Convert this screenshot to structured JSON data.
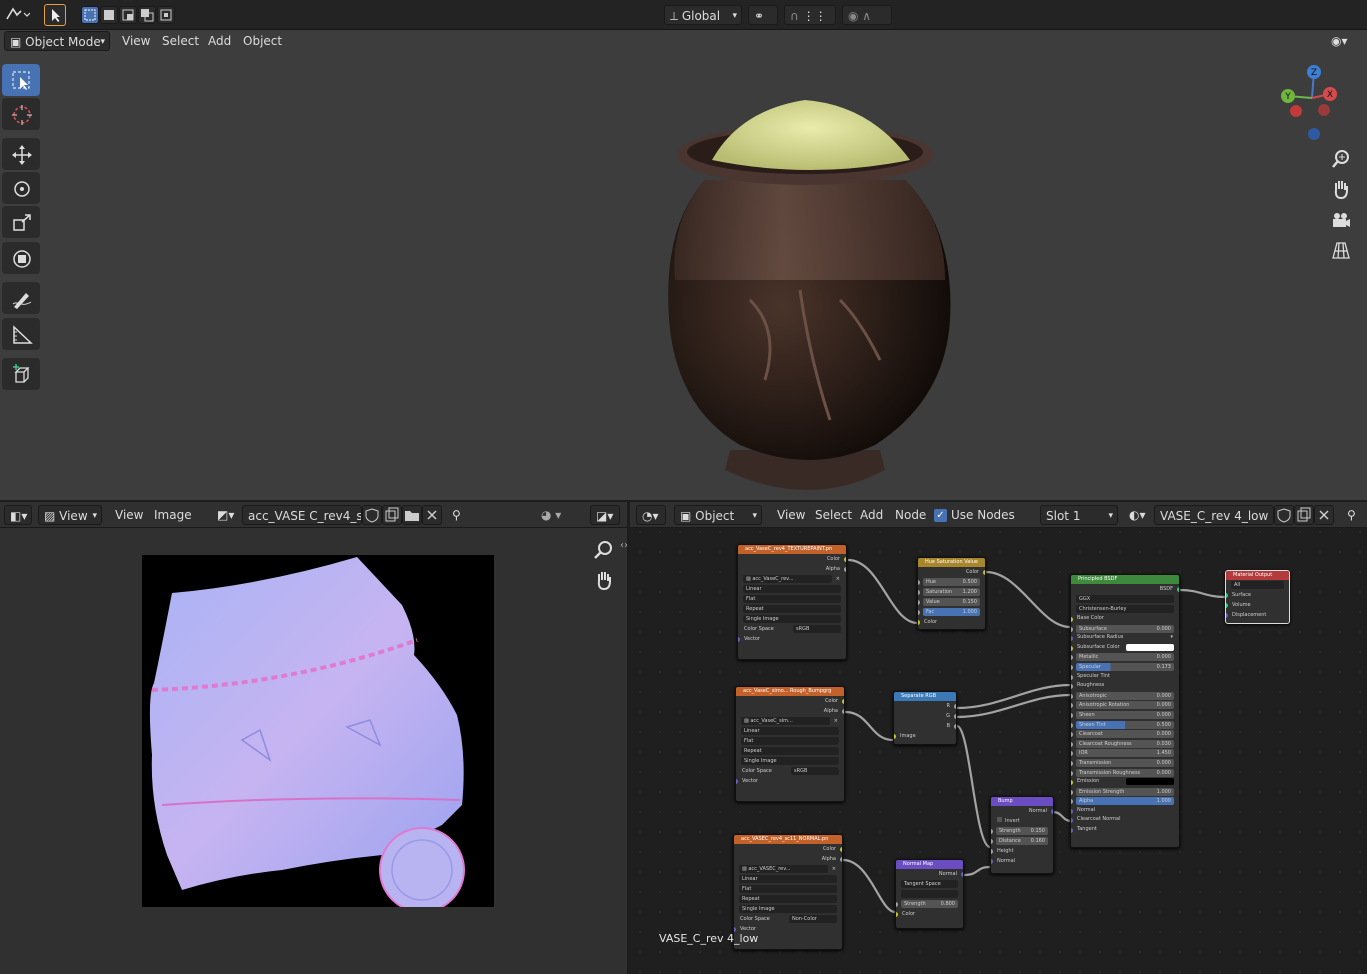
{
  "topbar": {
    "orientation": "Global"
  },
  "viewport": {
    "mode": "Object Mode",
    "menus": [
      "View",
      "Select",
      "Add",
      "Object"
    ],
    "gizmo": {
      "z": "Z",
      "y": "Y",
      "x": "X"
    }
  },
  "image_editor": {
    "view_dropdown": "View",
    "menus": [
      "View",
      "Image"
    ],
    "image_name": "acc_VASE C_rev4_si..."
  },
  "node_editor": {
    "object_dropdown": "Object",
    "menus": [
      "View",
      "Select",
      "Add",
      "Node"
    ],
    "use_nodes_label": "Use Nodes",
    "slot": "Slot 1",
    "material": "VASE_C_rev 4_low",
    "footer_label": "VASE_C_rev 4_low",
    "colors": {
      "accent": "#4772b3",
      "texture_header": "#c2622a",
      "color_header": "#a8862b",
      "converter_header": "#3a79b5",
      "vector_header": "#6a4ec1",
      "shader_header": "#3d8a3d",
      "output_header": "#b33b3b"
    },
    "nodes": {
      "tex1": {
        "title": "acc_VaseC_rev4_TEXTUREPAINT.pn",
        "out_color": "Color",
        "out_alpha": "Alpha",
        "image": "acc_VaseC_rev...",
        "interp": "Linear",
        "proj": "Flat",
        "ext": "Repeat",
        "src": "Single Image",
        "cs_label": "Color Space",
        "cs_value": "sRGB",
        "vector": "Vector"
      },
      "tex2": {
        "title": "acc_VaseC_simo... Rough_Bumpgrg",
        "out_color": "Color",
        "out_alpha": "Alpha",
        "image": "acc_VaseC_sim...",
        "interp": "Linear",
        "proj": "Flat",
        "ext": "Repeat",
        "src": "Single Image",
        "cs_label": "Color Space",
        "cs_value": "sRGB",
        "vector": "Vector"
      },
      "tex3": {
        "title": "acc_VASEC_rev4_sc11_NORMAL.pn",
        "out_color": "Color",
        "out_alpha": "Alpha",
        "image": "acc_VASEC_rev...",
        "interp": "Linear",
        "proj": "Flat",
        "ext": "Repeat",
        "src": "Single Image",
        "cs_label": "Color Space",
        "cs_value": "Non-Color",
        "vector": "Vector"
      },
      "hsv": {
        "title": "Hue Saturation Value",
        "out": "Color",
        "hue_l": "Hue",
        "hue_v": "0.500",
        "sat_l": "Saturation",
        "sat_v": "1.200",
        "val_l": "Value",
        "val_v": "0.150",
        "fac_l": "Fac",
        "fac_v": "1.000",
        "color_in": "Color"
      },
      "sep": {
        "title": "Separate RGB",
        "r": "R",
        "g": "G",
        "b": "B",
        "image": "Image"
      },
      "bump": {
        "title": "Bump",
        "out": "Normal",
        "invert": "Invert",
        "str_l": "Strength",
        "str_v": "0.150",
        "dist_l": "Distance",
        "dist_v": "0.160",
        "height": "Height",
        "normal": "Normal"
      },
      "nmap": {
        "title": "Normal Map",
        "out": "Normal",
        "space": "Tangent Space",
        "str_l": "Strength",
        "str_v": "0.800",
        "color": "Color"
      },
      "bsdf": {
        "title": "Principled BSDF",
        "out": "BSDF",
        "dist": "GGX",
        "sss": "Christensen-Burley",
        "rows": [
          {
            "l": "Base Color",
            "v": ""
          },
          {
            "l": "Subsurface",
            "v": "0.000"
          },
          {
            "l": "Subsurface Radius",
            "v": ""
          },
          {
            "l": "Subsurface Color",
            "v": ""
          },
          {
            "l": "Metallic",
            "v": "0.000"
          },
          {
            "l": "Specular",
            "v": "0.173"
          },
          {
            "l": "Specular Tint",
            "v": ""
          },
          {
            "l": "Roughness",
            "v": ""
          },
          {
            "l": "Anisotropic",
            "v": "0.000"
          },
          {
            "l": "Anisotropic Rotation",
            "v": "0.000"
          },
          {
            "l": "Sheen",
            "v": "0.000"
          },
          {
            "l": "Sheen Tint",
            "v": "0.500"
          },
          {
            "l": "Clearcoat",
            "v": "0.000"
          },
          {
            "l": "Clearcoat Roughness",
            "v": "0.030"
          },
          {
            "l": "IOR",
            "v": "1.450"
          },
          {
            "l": "Transmission",
            "v": "0.000"
          },
          {
            "l": "Transmission Roughness",
            "v": "0.000"
          },
          {
            "l": "Emission",
            "v": ""
          },
          {
            "l": "Emission Strength",
            "v": "1.000"
          },
          {
            "l": "Alpha",
            "v": "1.000"
          },
          {
            "l": "Normal",
            "v": ""
          },
          {
            "l": "Clearcoat Normal",
            "v": ""
          },
          {
            "l": "Tangent",
            "v": ""
          }
        ]
      },
      "out": {
        "title": "Material Output",
        "target": "All",
        "surface": "Surface",
        "volume": "Volume",
        "disp": "Displacement"
      }
    }
  }
}
